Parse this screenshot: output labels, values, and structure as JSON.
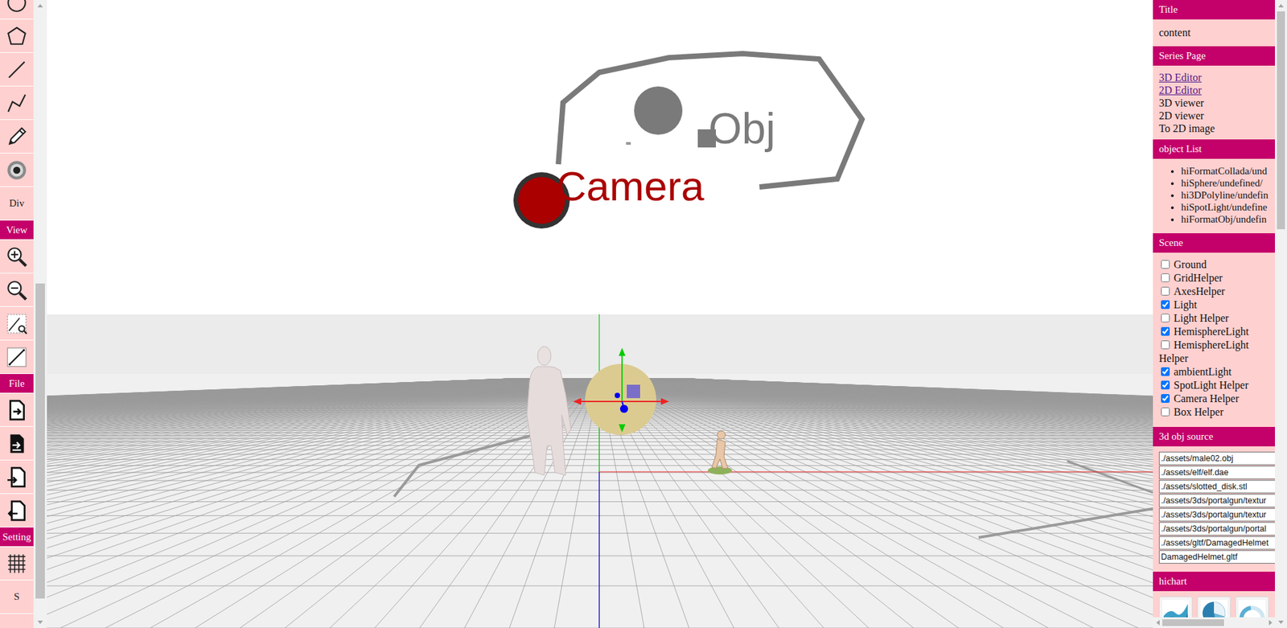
{
  "toolbar": {
    "items": [
      {
        "kind": "icon"
      },
      {
        "kind": "icon"
      },
      {
        "kind": "icon"
      },
      {
        "kind": "icon"
      },
      {
        "kind": "icon"
      },
      {
        "kind": "icon"
      },
      {
        "kind": "text",
        "label": "Div"
      },
      {
        "kind": "header",
        "label": "View"
      },
      {
        "kind": "icon"
      },
      {
        "kind": "icon"
      },
      {
        "kind": "icon"
      },
      {
        "kind": "icon"
      },
      {
        "kind": "header",
        "label": "File"
      },
      {
        "kind": "icon"
      },
      {
        "kind": "icon"
      },
      {
        "kind": "icon"
      },
      {
        "kind": "icon"
      },
      {
        "kind": "header",
        "label": "Setting"
      },
      {
        "kind": "icon"
      },
      {
        "kind": "text",
        "label": "S"
      }
    ]
  },
  "scrollbars": {
    "toolbar": {
      "offset": 0.45,
      "level": 0.52
    },
    "panel": {
      "offset": 0.0,
      "level": 0.36
    },
    "panel_horizontal": {
      "offset": 0.0,
      "level": 0.6
    }
  },
  "canvas2d": {
    "labels": [
      {
        "text": "Obj",
        "color": "#7a7a7a"
      },
      {
        "text": "Camera",
        "color": "#aa0000"
      }
    ]
  },
  "panel": {
    "sections": [
      {
        "title": "Title",
        "kind": "text",
        "text": "content"
      },
      {
        "title": "Series Page",
        "kind": "links",
        "items": [
          {
            "label": "3D Editor",
            "link": true
          },
          {
            "label": "2D Editor",
            "link": true
          },
          {
            "label": "3D viewer",
            "link": false
          },
          {
            "label": "2D viewer",
            "link": false
          },
          {
            "label": "To 2D image",
            "link": false
          }
        ]
      },
      {
        "title": "object List",
        "kind": "list",
        "items": [
          "hiFormatCollada/und",
          "hiSphere/undefined/",
          "hi3DPolyline/undefin",
          "hiSpotLight/undefine",
          "hiFormatObj/undefin"
        ]
      },
      {
        "title": "Scene",
        "kind": "checks",
        "items": [
          {
            "label": "Ground",
            "checked": false
          },
          {
            "label": "GridHelper",
            "checked": false
          },
          {
            "label": "AxesHelper",
            "checked": false
          },
          {
            "label": "Light",
            "checked": true
          },
          {
            "label": "Light Helper",
            "checked": false
          },
          {
            "label": "HemisphereLight",
            "checked": true
          },
          {
            "label": "HemisphereLight Helper",
            "checked": false
          },
          {
            "label": "ambientLight",
            "checked": true
          },
          {
            "label": "SpotLight Helper",
            "checked": true
          },
          {
            "label": "Camera Helper",
            "checked": true
          },
          {
            "label": "Box Helper",
            "checked": false
          }
        ]
      },
      {
        "title": "3d obj source",
        "kind": "inputs",
        "items": [
          "./assets/male02.obj",
          "./assets/elf/elf.dae",
          "./assets/slotted_disk.stl",
          "./assets/3ds/portalgun/textur",
          "./assets/3ds/portalgun/textur",
          "./assets/3ds/portalgun/portal",
          "./assets/gltf/DamagedHelmet",
          "DamagedHelmet.gltf"
        ]
      },
      {
        "title": "hichart",
        "kind": "thumbs",
        "items": [
          {
            "kind": "area"
          },
          {
            "kind": "pie"
          },
          {
            "kind": "gauge"
          }
        ]
      }
    ]
  }
}
